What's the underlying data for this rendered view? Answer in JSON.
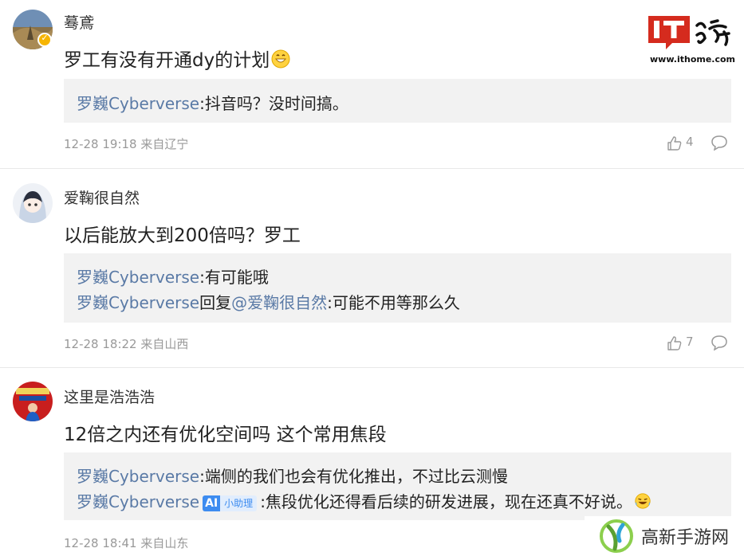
{
  "logo": {
    "url_text": "www.ithome.com",
    "brand_color": "#d52b1e"
  },
  "comments": [
    {
      "username": "蓦鳶",
      "content": "罗工有没有开通dy的计划",
      "replies": [
        {
          "author": "罗巍Cyberverse",
          "text": ":抖音吗？没时间搞。"
        }
      ],
      "meta": "12-28 19:18 来自辽宁",
      "likes": "4"
    },
    {
      "username": "爱鞠很自然",
      "content": "以后能放大到200倍吗？罗工",
      "replies": [
        {
          "author": "罗巍Cyberverse",
          "text": ":有可能哦"
        },
        {
          "author": "罗巍Cyberverse",
          "mid": "回复",
          "mention": "@爱鞠很自然",
          "text": ":可能不用等那么久"
        }
      ],
      "meta": "12-28 18:22 来自山西",
      "likes": "7"
    },
    {
      "username": "这里是浩浩浩",
      "content": "12倍之内还有优化空间吗 这个常用焦段",
      "replies": [
        {
          "author": "罗巍Cyberverse",
          "text": ":端侧的我们也会有优化推出，不过比云测慢"
        },
        {
          "author": "罗巍Cyberverse",
          "badge_ai": "AI",
          "badge_label": "小助理",
          "text": ":焦段优化还得看后续的研发进展，现在还真不好说。"
        }
      ],
      "meta": "12-28 18:41 来自山东"
    }
  ],
  "watermark": {
    "text": "高新手游网"
  },
  "colors": {
    "link": "#5a7aa6",
    "reply_bg": "#f2f2f2",
    "meta": "#999999",
    "badge": "#3d8cf0"
  }
}
